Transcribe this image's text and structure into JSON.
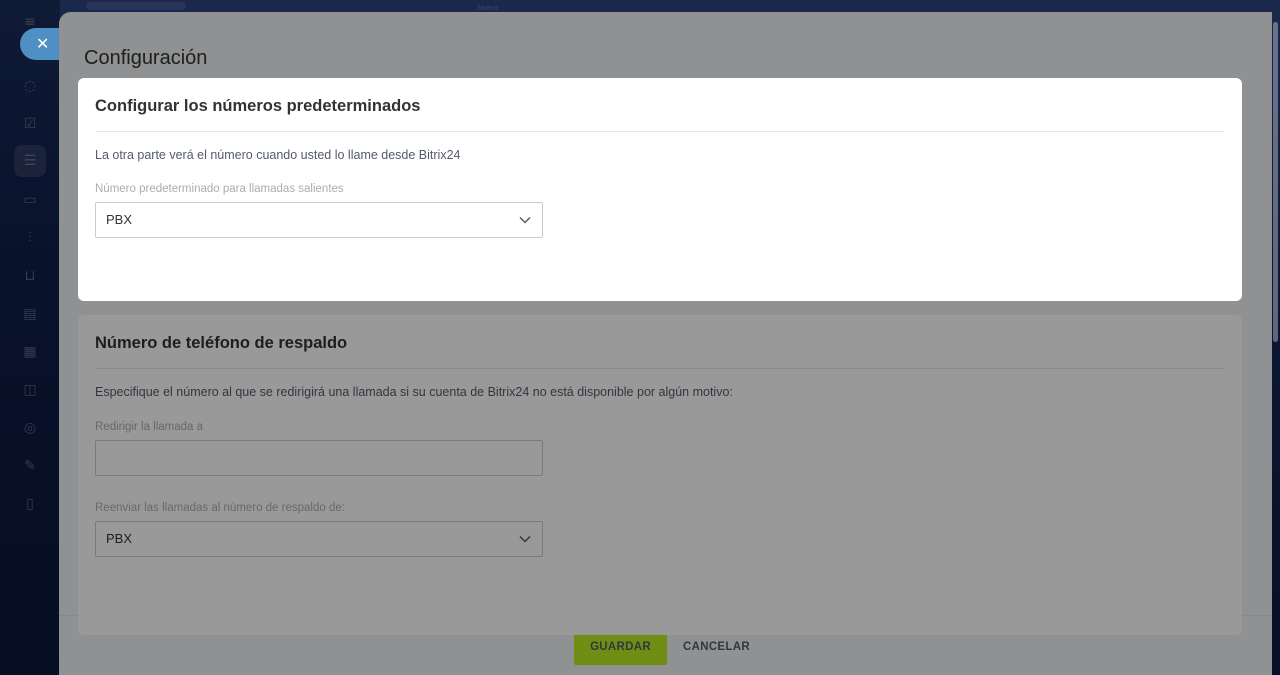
{
  "background": {
    "topbar_text": "Nuevo"
  },
  "close_button": {
    "glyph": "✕"
  },
  "page": {
    "title": "Configuración"
  },
  "default_numbers": {
    "title": "Configurar los números predeterminados",
    "description": "La otra parte verá el número cuando usted lo llame desde Bitrix24",
    "outgoing_label": "Número predeterminado para llamadas salientes",
    "outgoing_value": "PBX"
  },
  "backup_phone": {
    "title": "Número de teléfono de respaldo",
    "description": "Especifique el número al que se redirigirá una llamada si su cuenta de Bitrix24 no está disponible por algún motivo:",
    "redirect_label": "Redirigir la llamada a",
    "redirect_value": "",
    "forward_label": "Reenviar las llamadas al número de respaldo de:",
    "forward_value": "PBX"
  },
  "footer": {
    "save_label": "GUARDAR",
    "cancel_label": "CANCELAR"
  },
  "colors": {
    "save_button": "#bbed21",
    "close_button": "#4f8fc4"
  }
}
